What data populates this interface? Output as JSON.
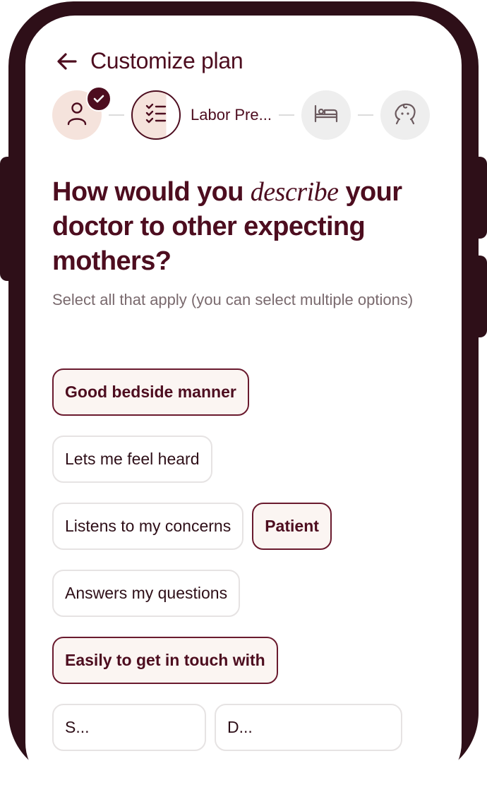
{
  "header": {
    "back_icon": "arrow-left-icon",
    "title": "Customize plan"
  },
  "stepper": {
    "steps": [
      {
        "icon": "person-icon",
        "status": "completed",
        "badge_icon": "check-icon"
      },
      {
        "icon": "checklist-icon",
        "status": "current",
        "label": "Labor Pre..."
      },
      {
        "icon": "bed-icon",
        "status": "upcoming"
      },
      {
        "icon": "baby-icon",
        "status": "upcoming"
      }
    ]
  },
  "question": {
    "before": "How would you ",
    "emphasis": "describe",
    "after": " your doctor to other expecting mothers?"
  },
  "helper_text": "Select all that apply (you can select multiple options)",
  "options": [
    {
      "label": "Good bedside manner",
      "selected": true
    },
    {
      "label": "Lets me feel heard",
      "selected": false
    },
    {
      "label": "Listens to my concerns",
      "selected": false
    },
    {
      "label": "Patient",
      "selected": true
    },
    {
      "label": "Answers my questions",
      "selected": false
    },
    {
      "label": "Easily to get in touch with",
      "selected": true
    },
    {
      "label": "S...",
      "selected": false
    },
    {
      "label": "D...",
      "selected": false
    }
  ],
  "colors": {
    "brand": "#4d0d1f",
    "frame": "#2e0f18",
    "completed_step_bg": "#f5e3dc",
    "upcoming_step_bg": "#eeeeee",
    "selected_chip_bg": "#fbf5f2",
    "chip_border": "#e6e3e3",
    "helper_text": "#7a6a6e"
  }
}
